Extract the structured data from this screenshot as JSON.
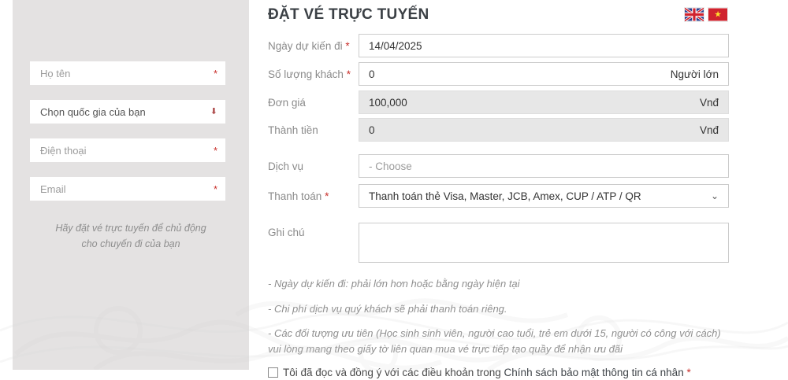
{
  "header": {
    "title": "ĐẶT VÉ TRỰC TUYẾN",
    "flags": {
      "english": "uk-flag",
      "vietnamese": "vn-flag"
    }
  },
  "sidebar": {
    "fields": [
      {
        "placeholder": "Họ tên",
        "required": "*"
      },
      {
        "label": "Chọn quốc gia của bạn",
        "arrow_icon": "chevron-down-icon"
      },
      {
        "placeholder": "Điện thoại",
        "required": "*"
      },
      {
        "placeholder": "Email",
        "required": "*"
      }
    ],
    "tagline_line1": "Hãy đặt vé trực tuyến để chủ động",
    "tagline_line2": "cho chuyến đi của bạn"
  },
  "form": {
    "rows": [
      {
        "label": "Ngày dự kiến đi",
        "required": "*",
        "value": "14/04/2025"
      },
      {
        "label": "Số lượng khách",
        "required": "*",
        "value": "0",
        "suffix": "Người lớn"
      },
      {
        "label": "Đơn giá",
        "value": "100,000",
        "suffix": "Vnđ"
      },
      {
        "label": "Thành tiền",
        "value": "0",
        "suffix": "Vnđ"
      },
      {
        "label": "Dịch vụ",
        "placeholder": "- Choose"
      },
      {
        "label": "Thanh toán",
        "required": "*",
        "value": "Thanh toán thẻ Visa, Master, JCB, Amex, CUP / ATP / QR"
      },
      {
        "label": "Ghi chú",
        "value": ""
      }
    ]
  },
  "notes": [
    "- Ngày dự kiến đi: phải lớn hơn hoặc bằng ngày hiện tại",
    "- Chi phí dịch vụ quý khách sẽ phải thanh toán riêng.",
    "- Các đối tượng ưu tiên (Học sinh sinh viên, người cao tuổi, trẻ em dưới 15, người có công với cách) vui lòng mang theo giấy tờ liên quan mua vé trực tiếp tạo quầy để nhận ưu đãi"
  ],
  "consent": {
    "text": "Tôi đã đọc và đồng ý với các điều khoản trong",
    "link": "Chính sách bảo mật thông tin cá nhân",
    "required": "*"
  },
  "colors": {
    "accent_red": "#c9302c",
    "panel_gray": "#e4e2e2",
    "disabled_gray": "#e7e7e7",
    "label_gray": "#8b8b8b",
    "title_dark": "#3b4045"
  }
}
